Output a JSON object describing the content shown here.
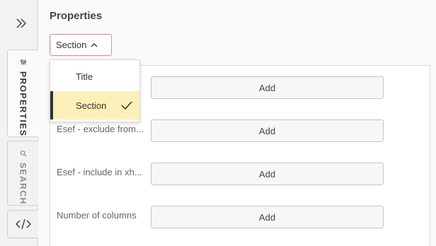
{
  "rail": {
    "tabs": [
      {
        "label": "PROPERTIES",
        "icon": "sliders-icon",
        "active": true
      },
      {
        "label": "SEARCH",
        "icon": "search-icon",
        "active": false
      },
      {
        "label": "",
        "icon": "code-icon",
        "active": false
      }
    ]
  },
  "panel": {
    "title": "Properties",
    "type_select": {
      "value": "Section"
    },
    "dropdown": {
      "options": [
        {
          "label": "Title",
          "selected": false
        },
        {
          "label": "Section",
          "selected": true
        }
      ]
    },
    "rows": [
      {
        "label": "",
        "button": "Add"
      },
      {
        "label": "Esef - exclude from...",
        "button": "Add"
      },
      {
        "label": "Esef - include in xh...",
        "button": "Add"
      },
      {
        "label": "Number of columns",
        "button": "Add"
      }
    ]
  },
  "colors": {
    "select_border": "#e48aa0",
    "selected_option_bg": "#fbf1b8",
    "selected_option_bar": "#333333"
  }
}
